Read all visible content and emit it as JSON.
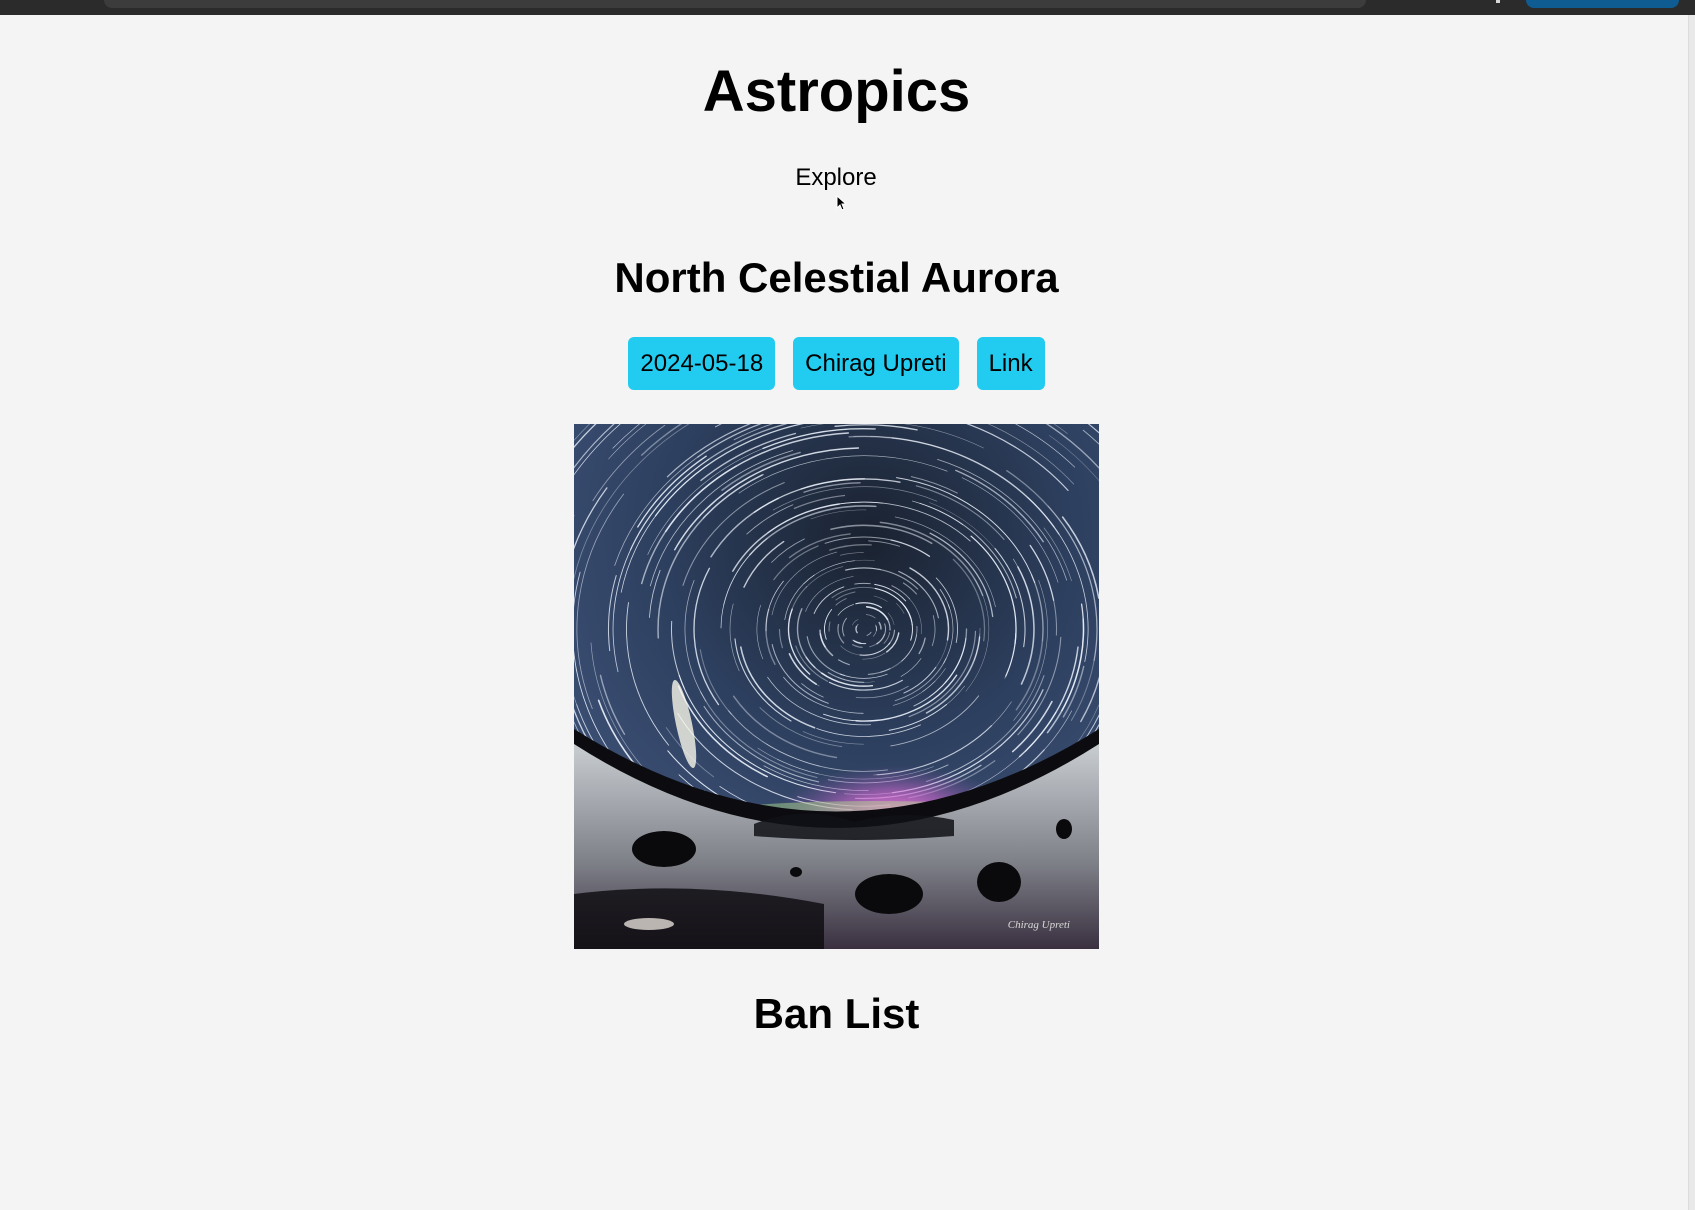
{
  "app": {
    "title": "Astropics"
  },
  "nav": {
    "explore_label": "Explore"
  },
  "picture": {
    "title": "North Celestial Aurora",
    "tags": {
      "date": "2024-05-18",
      "author": "Chirag Upreti",
      "link": "Link"
    },
    "watermark": "Chirag Upreti"
  },
  "ban_list": {
    "title": "Ban List"
  },
  "colors": {
    "tag_background": "#22ccf0",
    "page_background": "#f4f4f4",
    "browser_bar": "#2b2b2b",
    "profile_button": "#0f5c93"
  },
  "icons": {
    "cursor": "mouse-pointer-icon"
  }
}
